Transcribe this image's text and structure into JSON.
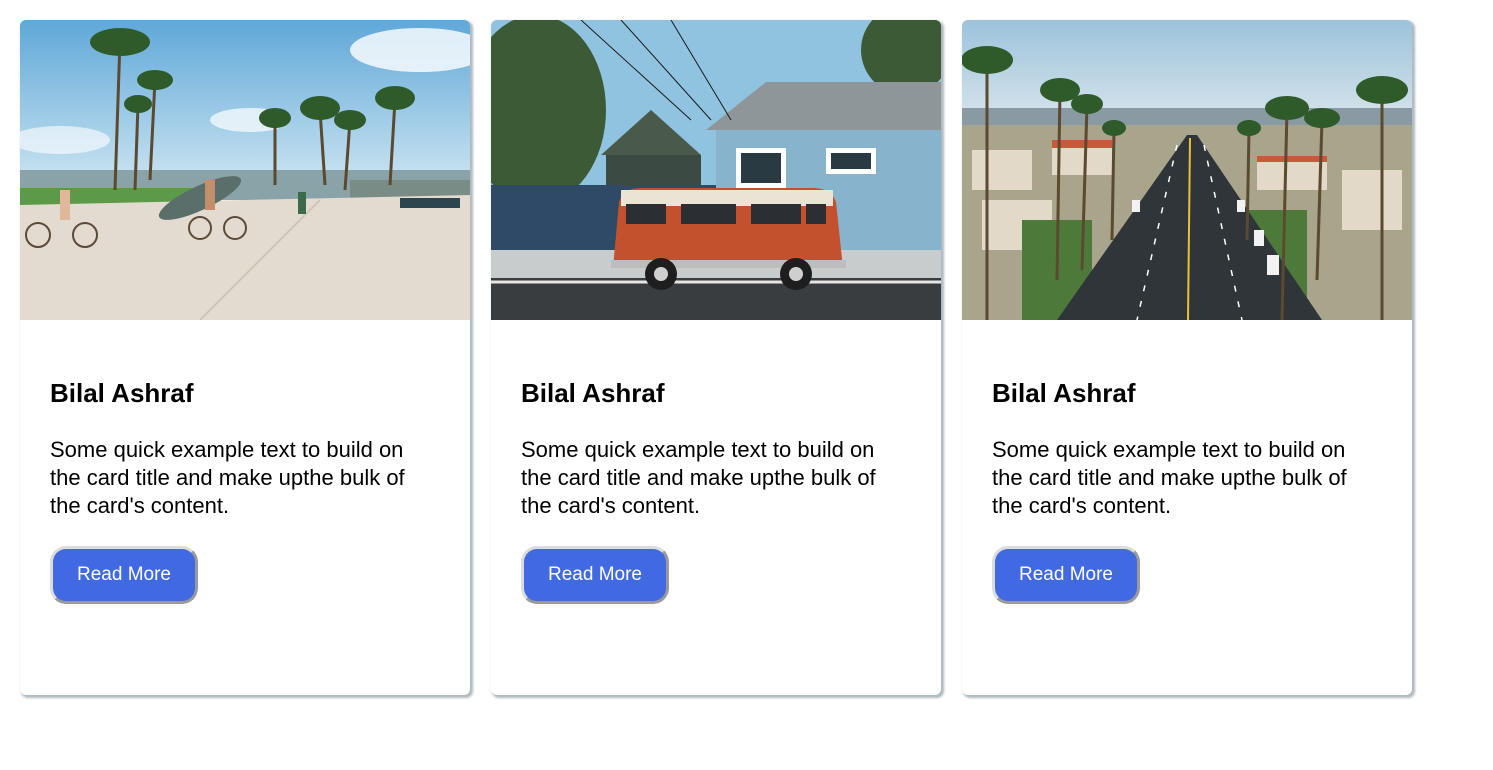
{
  "cards": [
    {
      "image": "beach-boardwalk-photo",
      "title": "Bilal Ashraf",
      "text": "Some quick example text to build on the card title and make upthe bulk of the card's content.",
      "button_label": "Read More"
    },
    {
      "image": "red-van-house-photo",
      "title": "Bilal Ashraf",
      "text": "Some quick example text to build on the card title and make upthe bulk of the card's content.",
      "button_label": "Read More"
    },
    {
      "image": "palm-street-aerial-photo",
      "title": "Bilal Ashraf",
      "text": "Some quick example text to build on the card title and make upthe bulk of the card's content.",
      "button_label": "Read More"
    }
  ],
  "colors": {
    "button_bg": "#4169e1",
    "button_text": "#ffffff",
    "title_text": "#000000"
  }
}
